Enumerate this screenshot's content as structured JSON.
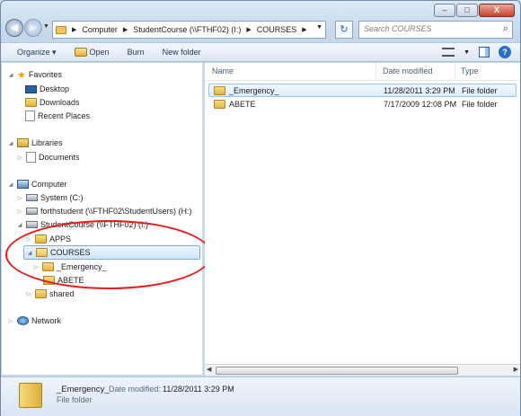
{
  "window": {
    "caption_buttons": {
      "minimize": "–",
      "maximize": "□",
      "close": "X"
    }
  },
  "address": {
    "crumbs": [
      "Computer",
      "StudentCourse (\\\\FTHF02) (I:)",
      "COURSES"
    ],
    "search_placeholder": "Search COURSES"
  },
  "toolbar": {
    "organize": "Organize ▾",
    "open": "Open",
    "burn": "Burn",
    "new_folder": "New folder"
  },
  "nav": {
    "favorites": "Favorites",
    "desktop": "Desktop",
    "downloads": "Downloads",
    "recent": "Recent Places",
    "libraries": "Libraries",
    "documents": "Documents",
    "computer": "Computer",
    "system": "System (C:)",
    "forthstudent": "forthstudent (\\\\FTHF02\\StudentUsers) (H:)",
    "studentcourse": "StudentCourse (\\\\FTHF02) (I:)",
    "apps": "APPS",
    "courses": "COURSES",
    "emergency": "_Emergency_",
    "abete": "ABETE",
    "shared": "shared",
    "network": "Network"
  },
  "columns": {
    "name": "Name",
    "date": "Date modified",
    "type": "Type"
  },
  "files": [
    {
      "name": "_Emergency_",
      "date": "11/28/2011 3:29 PM",
      "type": "File folder"
    },
    {
      "name": "ABETE",
      "date": "7/17/2009 12:08 PM",
      "type": "File folder"
    }
  ],
  "details": {
    "name": "_Emergency_",
    "date_label": "Date modified:",
    "date": "11/28/2011 3:29 PM",
    "kind": "File folder"
  },
  "colors": {
    "annotation": "#e31b1b",
    "selection": "#cfe6fb"
  }
}
